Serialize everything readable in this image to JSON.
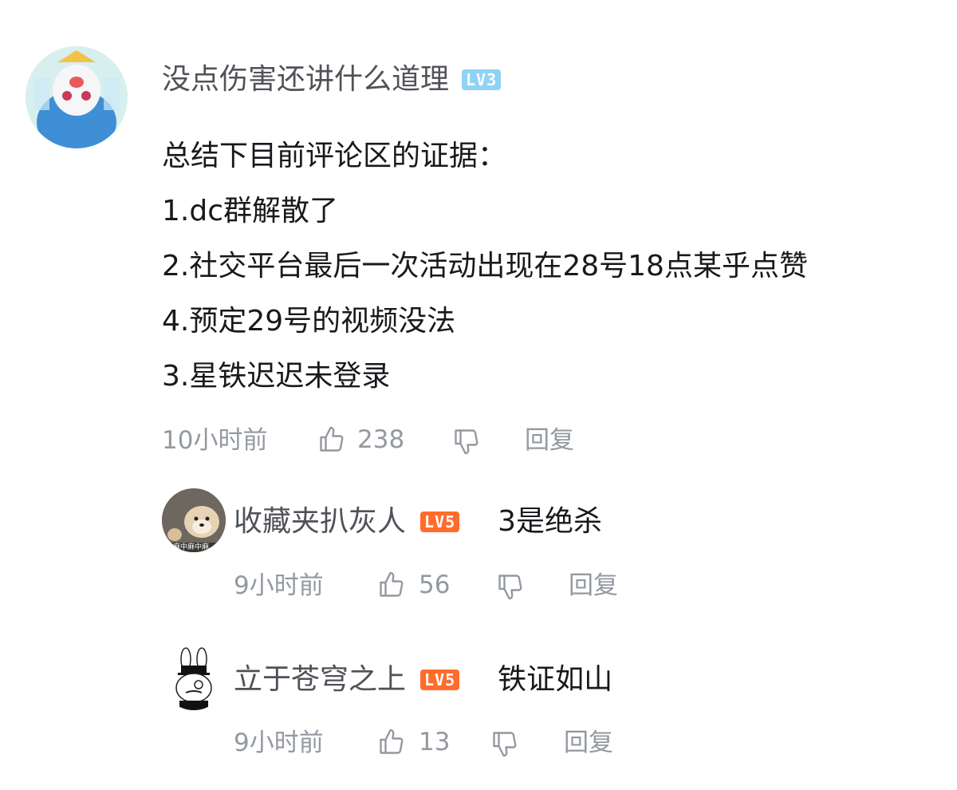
{
  "comments": [
    {
      "username": "没点伤害还讲什么道理",
      "level": "LV3",
      "level_color": "#8fd3f4",
      "content_lines": [
        "总结下目前评论区的证据：",
        "1.dc群解散了",
        "2.社交平台最后一次活动出现在28号18点某乎点赞",
        "4.预定29号的视频没法",
        "3.星铁迟迟未登录"
      ],
      "time": "10小时前",
      "likes": "238",
      "reply_label": "回复"
    }
  ],
  "replies": [
    {
      "username": "收藏夹扒灰人",
      "level": "LV5",
      "level_color": "#ff6c2c",
      "content": "3是绝杀",
      "avatar_caption": "麻中麻中麻",
      "time": "9小时前",
      "likes": "56",
      "reply_label": "回复"
    },
    {
      "username": "立于苍穹之上",
      "level": "LV5",
      "level_color": "#ff6c2c",
      "content": "铁证如山",
      "time": "9小时前",
      "likes": "13",
      "reply_label": "回复"
    }
  ],
  "icons": {
    "like": "thumbs-up-icon",
    "dislike": "thumbs-down-icon"
  },
  "colors": {
    "meta_text": "#9499a0",
    "username_text": "#505258",
    "content_text": "#18191c"
  }
}
